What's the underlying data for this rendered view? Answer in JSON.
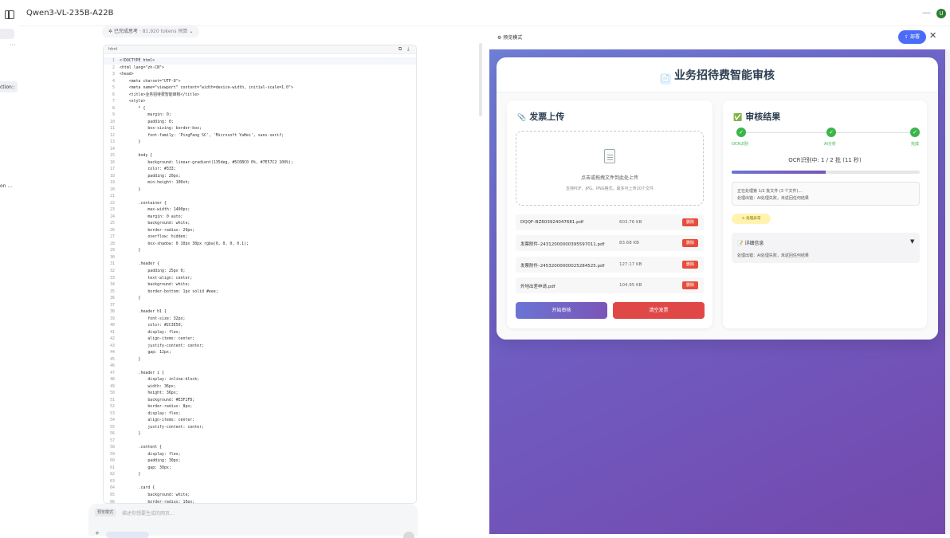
{
  "app": {
    "model_name": "Qwen3-VL-235B-A22B",
    "avatar_letter": "U"
  },
  "sidebar": {
    "snippets": [
      "ction::",
      "on ..."
    ]
  },
  "thinking": {
    "label": "已完成思考",
    "tokens": "· 81,920 tokens 预算"
  },
  "code": {
    "language": "html",
    "lines": [
      "<!DOCTYPE html>",
      "<html lang=\"zh-CN\">",
      "<head>",
      "    <meta charset=\"UTF-8\">",
      "    <meta name=\"viewport\" content=\"width=device-width, initial-scale=1.0\">",
      "    <title>业务招待费智能审核</title>",
      "    <style>",
      "        * {",
      "            margin: 0;",
      "            padding: 0;",
      "            box-sizing: border-box;",
      "            font-family: 'PingFang SC', 'Microsoft YaHei', sans-serif;",
      "        }",
      "",
      "        body {",
      "            background: linear-gradient(135deg, #5C6BC0 0%, #7E57C2 100%);",
      "            color: #333;",
      "            padding: 20px;",
      "            min-height: 100vh;",
      "        }",
      "",
      "        .container {",
      "            max-width: 1400px;",
      "            margin: 0 auto;",
      "            background: white;",
      "            border-radius: 20px;",
      "            overflow: hidden;",
      "            box-shadow: 0 10px 30px rgba(0, 0, 0, 0.1);",
      "        }",
      "",
      "        .header {",
      "            padding: 25px 0;",
      "            text-align: center;",
      "            background: white;",
      "            border-bottom: 1px solid #eee;",
      "        }",
      "",
      "        .header h1 {",
      "            font-size: 32px;",
      "            color: #2C3E50;",
      "            display: flex;",
      "            align-items: center;",
      "            justify-content: center;",
      "            gap: 12px;",
      "        }",
      "",
      "        .header i {",
      "            display: inline-block;",
      "            width: 36px;",
      "            height: 36px;",
      "            background: #E3F2FD;",
      "            border-radius: 8px;",
      "            display: flex;",
      "            align-items: center;",
      "            justify-content: center;",
      "        }",
      "",
      "        .content {",
      "            display: flex;",
      "            padding: 30px;",
      "            gap: 30px;",
      "        }",
      "",
      "        .card {",
      "            background: white;",
      "            border-radius: 16px;",
      "            box-shadow: 0 4px 12px rgba(0, 0, 0, 0.05);"
    ]
  },
  "input": {
    "tag": "预览模式",
    "placeholder": "描述你想要生成的网页..."
  },
  "preview": {
    "mode_label": "预览模式",
    "deploy_label": "部署",
    "title": "业务招待费智能审核",
    "upload": {
      "title": "发票上传",
      "drop_main": "点击或拖拽文件到此处上传",
      "drop_sub": "支持PDF、JPG、PNG格式，最多可上传20个文件",
      "delete_label": "删除",
      "files": [
        {
          "name": "DQQF–BZ603924047681.pdf",
          "size": "603.76 KB"
        },
        {
          "name": "发票附件–24312000000395597011.pdf",
          "size": "83.68 KB"
        },
        {
          "name": "发票附件–24532000000025284525.pdf",
          "size": "127.17 KB"
        },
        {
          "name": "外地出差申请.pdf",
          "size": "104.95 KB"
        }
      ],
      "start_label": "开始审核",
      "clear_label": "清空发票"
    },
    "result": {
      "title": "审核结果",
      "steps": [
        "OCR识别",
        "AI分析",
        "完成"
      ],
      "progress_text": "OCR识别中: 1 / 2 批 (11 秒)",
      "progress": 0.5,
      "status_line1": "正在处理第 1/2 批文件 (3 个文件)...",
      "status_line2": "处理出错：AI处理失败，未返回任何结果",
      "warn_label": "处理异常",
      "detail_title": "详细信息",
      "detail_text": "处理出错：AI处理失败，未返回任何结果"
    }
  },
  "colors": {
    "accent": "#4a6cf7",
    "danger": "#e04848",
    "success": "#3ab54a",
    "gradient_start": "#6f7fd6",
    "gradient_end": "#7448ac"
  }
}
